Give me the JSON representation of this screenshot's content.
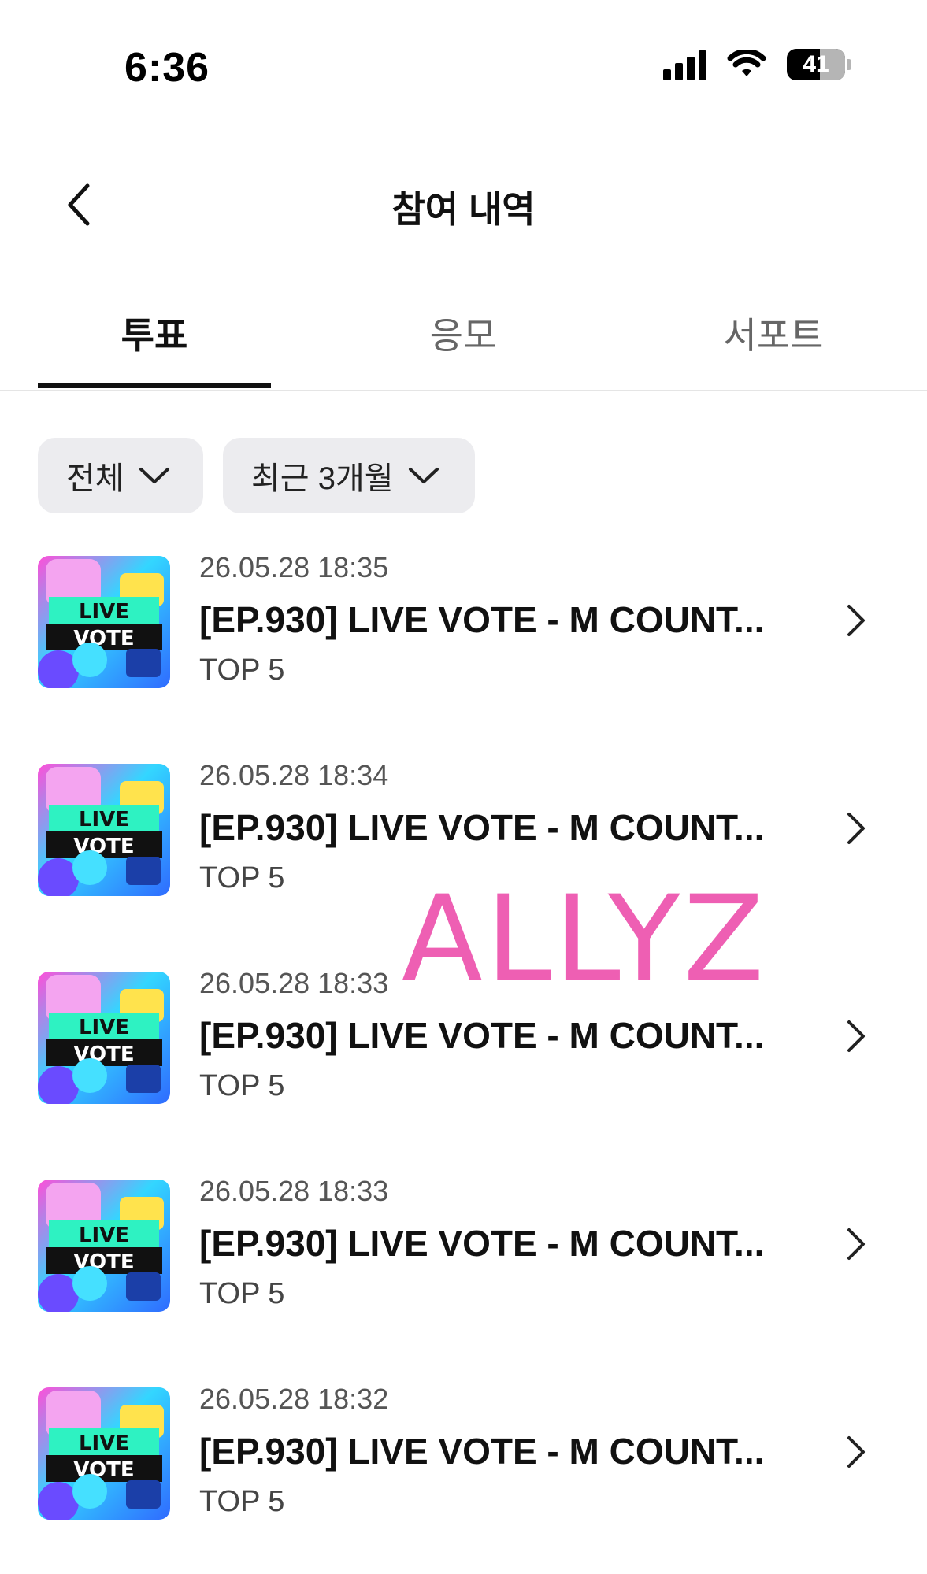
{
  "status_bar": {
    "time": "6:36",
    "battery": "41",
    "icons": [
      "signal-icon",
      "wifi-icon",
      "battery-icon"
    ]
  },
  "header": {
    "title": "참여 내역",
    "back_icon": "chevron-left-icon"
  },
  "tabs": [
    {
      "label": "투표",
      "active": true
    },
    {
      "label": "응모",
      "active": false
    },
    {
      "label": "서포트",
      "active": false
    }
  ],
  "filters": [
    {
      "label": "전체",
      "icon": "chevron-down-icon"
    },
    {
      "label": "최근 3개월",
      "icon": "chevron-down-icon"
    }
  ],
  "votes": [
    {
      "date": "26.05.28 18:35",
      "title": "[EP.930] LIVE VOTE - M COUNT...",
      "sub": "TOP 5",
      "thumb_text": [
        "LIVE",
        "VOTE"
      ]
    },
    {
      "date": "26.05.28 18:34",
      "title": "[EP.930] LIVE VOTE - M COUNT...",
      "sub": "TOP 5",
      "thumb_text": [
        "LIVE",
        "VOTE"
      ]
    },
    {
      "date": "26.05.28 18:33",
      "title": "[EP.930] LIVE VOTE - M COUNT...",
      "sub": "TOP 5",
      "thumb_text": [
        "LIVE",
        "VOTE"
      ]
    },
    {
      "date": "26.05.28 18:33",
      "title": "[EP.930] LIVE VOTE - M COUNT...",
      "sub": "TOP 5",
      "thumb_text": [
        "LIVE",
        "VOTE"
      ]
    },
    {
      "date": "26.05.28 18:32",
      "title": "[EP.930] LIVE VOTE - M COUNT...",
      "sub": "TOP 5",
      "thumb_text": [
        "LIVE",
        "VOTE"
      ]
    }
  ],
  "watermark": "ALLYZ",
  "colors": {
    "watermark": "#ee5fb3",
    "tab_active": "#111111",
    "tab_inactive": "#666666",
    "filter_bg": "#ececef"
  }
}
